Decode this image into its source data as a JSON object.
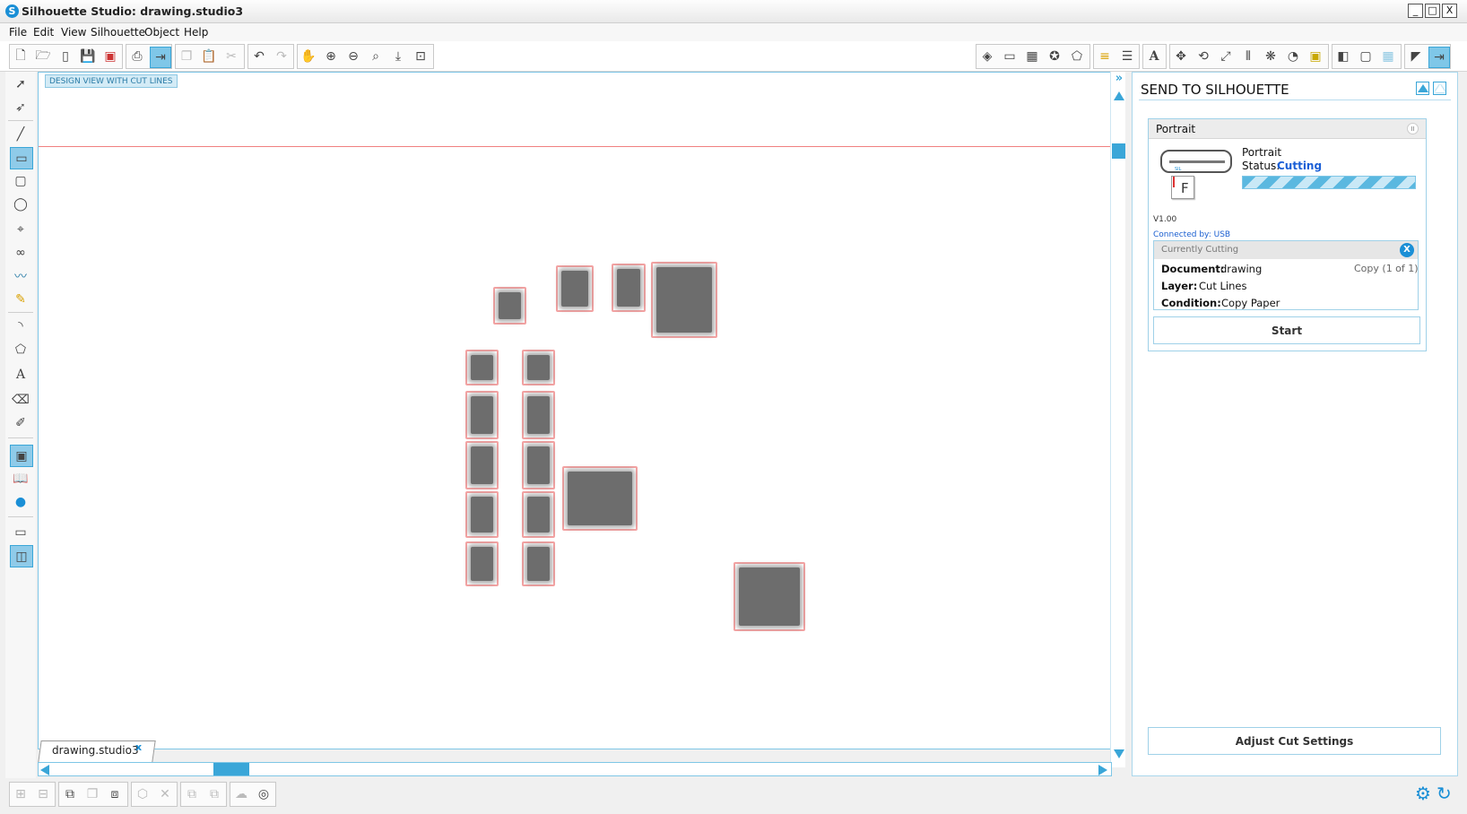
{
  "app": {
    "title": "Silhouette Studio: drawing.studio3"
  },
  "window_controls": [
    "_",
    "□",
    "X"
  ],
  "menu": [
    "File",
    "Edit",
    "View",
    "Silhouette",
    "Object",
    "Help"
  ],
  "canvas": {
    "view_label": "DESIGN VIEW WITH CUT LINES"
  },
  "document_tab": {
    "name": "drawing.studio3",
    "close": "x"
  },
  "panel": {
    "title": "SEND TO SILHOUETTE",
    "device": {
      "name": "Portrait",
      "model": "Portrait",
      "status_label": "Status:",
      "status_value": "Cutting",
      "version": "V1.00",
      "connection": "Connected by: USB",
      "pause_icon": "II",
      "cutter_letter": "F"
    },
    "cutting": {
      "header": "Currently Cutting",
      "close": "X",
      "document_label": "Document:",
      "document_value": "drawing",
      "copy_info": "Copy (1 of 1)",
      "layer_label": "Layer:",
      "layer_value": "Cut Lines",
      "condition_label": "Condition:",
      "condition_value": "Copy Paper"
    },
    "start_button": "Start",
    "adjust_button": "Adjust Cut Settings"
  },
  "colors": {
    "accent": "#3aa6d8",
    "status": "#1b5fd6",
    "cutline": "#f4a3a3",
    "shape_fill": "#6d6d6d"
  }
}
